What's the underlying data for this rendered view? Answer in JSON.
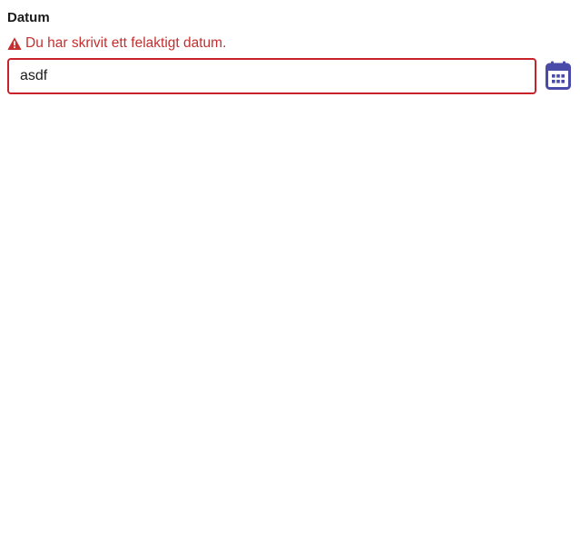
{
  "field": {
    "label": "Datum",
    "error_message": "Du har skrivit ett felaktigt datum.",
    "value": "asdf",
    "error_icon": "warning-triangle-icon",
    "calendar_icon": "calendar-icon"
  },
  "colors": {
    "error": "#c52f2f",
    "input_border_error": "#c8232b",
    "calendar_icon": "#4a4aa8",
    "text": "#1a1a1a"
  }
}
